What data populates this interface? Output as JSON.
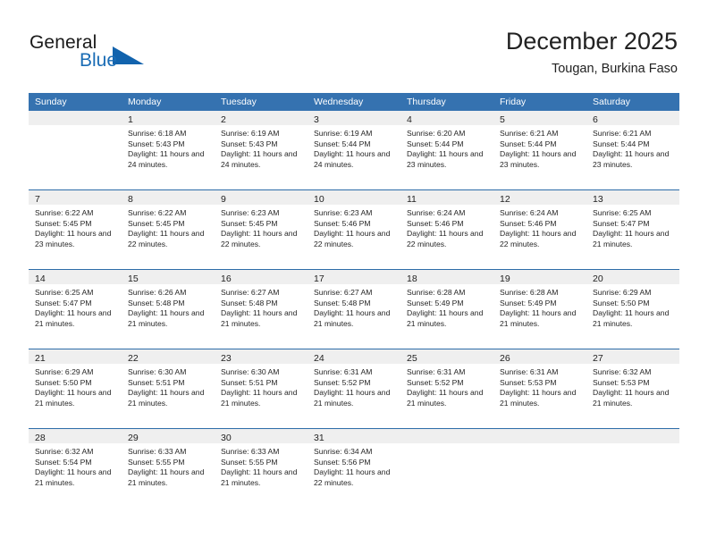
{
  "brand": {
    "name_part1": "General",
    "name_part2": "Blue",
    "flag_icon": "blue-flag-triangle-icon"
  },
  "header": {
    "title": "December 2025",
    "subtitle": "Tougan, Burkina Faso"
  },
  "colors": {
    "header_blue": "#3572b0",
    "row_divider_blue": "#2d6ca8",
    "daynum_band": "#efefef",
    "brand_blue": "#1a6cb5",
    "text": "#222222"
  },
  "weekdays": [
    "Sunday",
    "Monday",
    "Tuesday",
    "Wednesday",
    "Thursday",
    "Friday",
    "Saturday"
  ],
  "weeks": [
    [
      {
        "day": "",
        "blank": true
      },
      {
        "day": "1",
        "sunrise": "Sunrise: 6:18 AM",
        "sunset": "Sunset: 5:43 PM",
        "daylight": "Daylight: 11 hours and 24 minutes."
      },
      {
        "day": "2",
        "sunrise": "Sunrise: 6:19 AM",
        "sunset": "Sunset: 5:43 PM",
        "daylight": "Daylight: 11 hours and 24 minutes."
      },
      {
        "day": "3",
        "sunrise": "Sunrise: 6:19 AM",
        "sunset": "Sunset: 5:44 PM",
        "daylight": "Daylight: 11 hours and 24 minutes."
      },
      {
        "day": "4",
        "sunrise": "Sunrise: 6:20 AM",
        "sunset": "Sunset: 5:44 PM",
        "daylight": "Daylight: 11 hours and 23 minutes."
      },
      {
        "day": "5",
        "sunrise": "Sunrise: 6:21 AM",
        "sunset": "Sunset: 5:44 PM",
        "daylight": "Daylight: 11 hours and 23 minutes."
      },
      {
        "day": "6",
        "sunrise": "Sunrise: 6:21 AM",
        "sunset": "Sunset: 5:44 PM",
        "daylight": "Daylight: 11 hours and 23 minutes."
      }
    ],
    [
      {
        "day": "7",
        "sunrise": "Sunrise: 6:22 AM",
        "sunset": "Sunset: 5:45 PM",
        "daylight": "Daylight: 11 hours and 23 minutes."
      },
      {
        "day": "8",
        "sunrise": "Sunrise: 6:22 AM",
        "sunset": "Sunset: 5:45 PM",
        "daylight": "Daylight: 11 hours and 22 minutes."
      },
      {
        "day": "9",
        "sunrise": "Sunrise: 6:23 AM",
        "sunset": "Sunset: 5:45 PM",
        "daylight": "Daylight: 11 hours and 22 minutes."
      },
      {
        "day": "10",
        "sunrise": "Sunrise: 6:23 AM",
        "sunset": "Sunset: 5:46 PM",
        "daylight": "Daylight: 11 hours and 22 minutes."
      },
      {
        "day": "11",
        "sunrise": "Sunrise: 6:24 AM",
        "sunset": "Sunset: 5:46 PM",
        "daylight": "Daylight: 11 hours and 22 minutes."
      },
      {
        "day": "12",
        "sunrise": "Sunrise: 6:24 AM",
        "sunset": "Sunset: 5:46 PM",
        "daylight": "Daylight: 11 hours and 22 minutes."
      },
      {
        "day": "13",
        "sunrise": "Sunrise: 6:25 AM",
        "sunset": "Sunset: 5:47 PM",
        "daylight": "Daylight: 11 hours and 21 minutes."
      }
    ],
    [
      {
        "day": "14",
        "sunrise": "Sunrise: 6:25 AM",
        "sunset": "Sunset: 5:47 PM",
        "daylight": "Daylight: 11 hours and 21 minutes."
      },
      {
        "day": "15",
        "sunrise": "Sunrise: 6:26 AM",
        "sunset": "Sunset: 5:48 PM",
        "daylight": "Daylight: 11 hours and 21 minutes."
      },
      {
        "day": "16",
        "sunrise": "Sunrise: 6:27 AM",
        "sunset": "Sunset: 5:48 PM",
        "daylight": "Daylight: 11 hours and 21 minutes."
      },
      {
        "day": "17",
        "sunrise": "Sunrise: 6:27 AM",
        "sunset": "Sunset: 5:48 PM",
        "daylight": "Daylight: 11 hours and 21 minutes."
      },
      {
        "day": "18",
        "sunrise": "Sunrise: 6:28 AM",
        "sunset": "Sunset: 5:49 PM",
        "daylight": "Daylight: 11 hours and 21 minutes."
      },
      {
        "day": "19",
        "sunrise": "Sunrise: 6:28 AM",
        "sunset": "Sunset: 5:49 PM",
        "daylight": "Daylight: 11 hours and 21 minutes."
      },
      {
        "day": "20",
        "sunrise": "Sunrise: 6:29 AM",
        "sunset": "Sunset: 5:50 PM",
        "daylight": "Daylight: 11 hours and 21 minutes."
      }
    ],
    [
      {
        "day": "21",
        "sunrise": "Sunrise: 6:29 AM",
        "sunset": "Sunset: 5:50 PM",
        "daylight": "Daylight: 11 hours and 21 minutes."
      },
      {
        "day": "22",
        "sunrise": "Sunrise: 6:30 AM",
        "sunset": "Sunset: 5:51 PM",
        "daylight": "Daylight: 11 hours and 21 minutes."
      },
      {
        "day": "23",
        "sunrise": "Sunrise: 6:30 AM",
        "sunset": "Sunset: 5:51 PM",
        "daylight": "Daylight: 11 hours and 21 minutes."
      },
      {
        "day": "24",
        "sunrise": "Sunrise: 6:31 AM",
        "sunset": "Sunset: 5:52 PM",
        "daylight": "Daylight: 11 hours and 21 minutes."
      },
      {
        "day": "25",
        "sunrise": "Sunrise: 6:31 AM",
        "sunset": "Sunset: 5:52 PM",
        "daylight": "Daylight: 11 hours and 21 minutes."
      },
      {
        "day": "26",
        "sunrise": "Sunrise: 6:31 AM",
        "sunset": "Sunset: 5:53 PM",
        "daylight": "Daylight: 11 hours and 21 minutes."
      },
      {
        "day": "27",
        "sunrise": "Sunrise: 6:32 AM",
        "sunset": "Sunset: 5:53 PM",
        "daylight": "Daylight: 11 hours and 21 minutes."
      }
    ],
    [
      {
        "day": "28",
        "sunrise": "Sunrise: 6:32 AM",
        "sunset": "Sunset: 5:54 PM",
        "daylight": "Daylight: 11 hours and 21 minutes."
      },
      {
        "day": "29",
        "sunrise": "Sunrise: 6:33 AM",
        "sunset": "Sunset: 5:55 PM",
        "daylight": "Daylight: 11 hours and 21 minutes."
      },
      {
        "day": "30",
        "sunrise": "Sunrise: 6:33 AM",
        "sunset": "Sunset: 5:55 PM",
        "daylight": "Daylight: 11 hours and 21 minutes."
      },
      {
        "day": "31",
        "sunrise": "Sunrise: 6:34 AM",
        "sunset": "Sunset: 5:56 PM",
        "daylight": "Daylight: 11 hours and 22 minutes."
      },
      {
        "day": "",
        "blank": true
      },
      {
        "day": "",
        "blank": true
      },
      {
        "day": "",
        "blank": true
      }
    ]
  ]
}
